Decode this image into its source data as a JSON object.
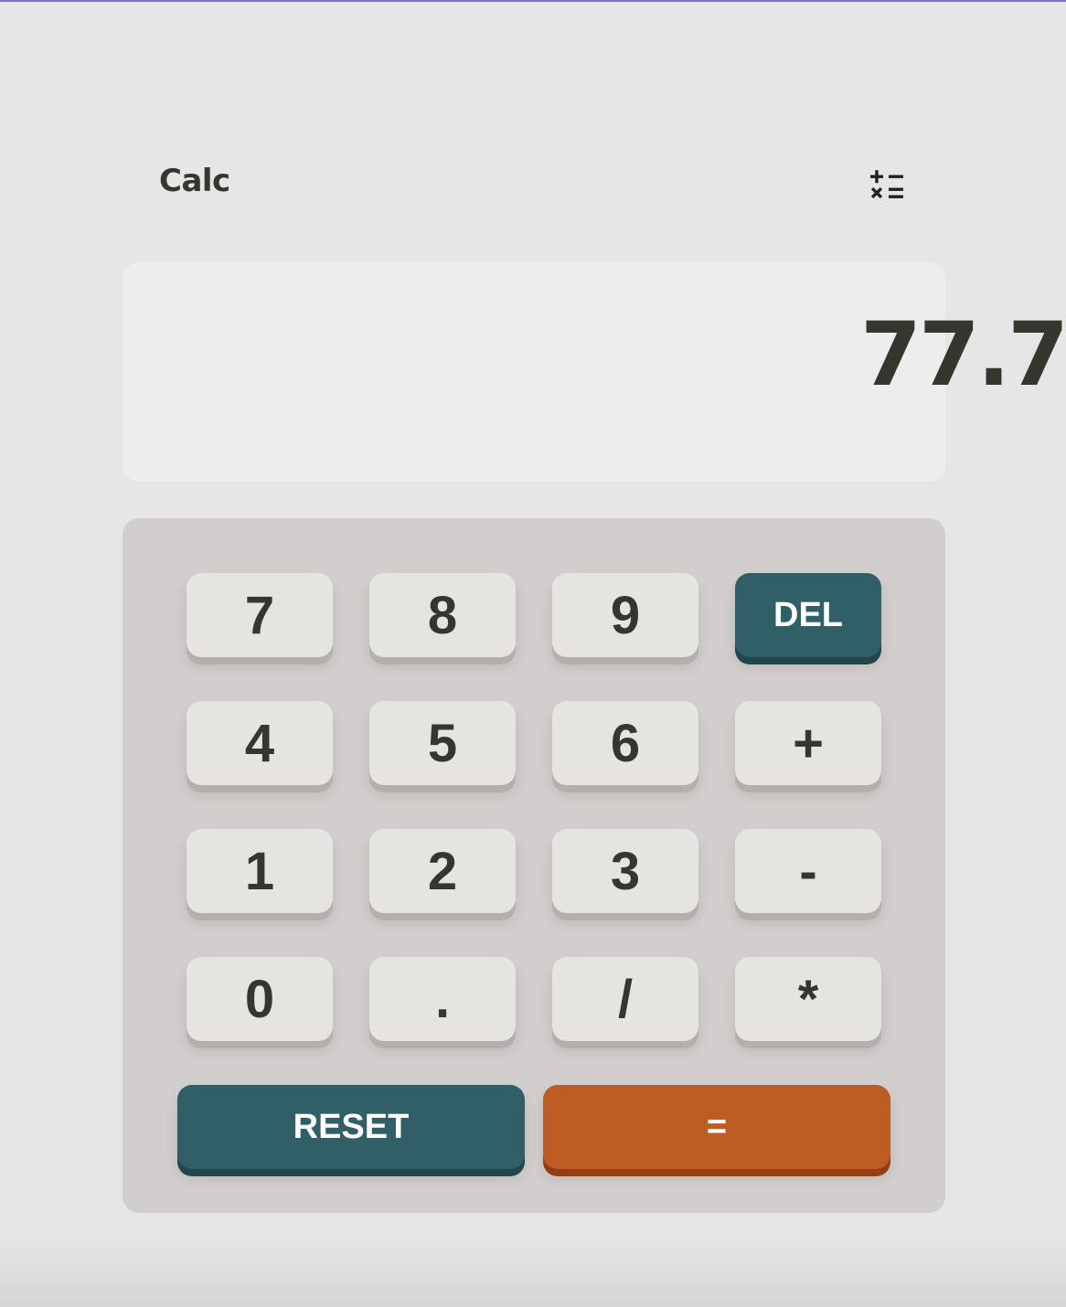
{
  "app": {
    "title": "Calc",
    "icon": "math-operators-icon"
  },
  "display": {
    "value": "77.7"
  },
  "keys": {
    "k7": "7",
    "k8": "8",
    "k9": "9",
    "del": "DEL",
    "k4": "4",
    "k5": "5",
    "k6": "6",
    "plus": "+",
    "k1": "1",
    "k2": "2",
    "k3": "3",
    "minus": "-",
    "k0": "0",
    "dot": ".",
    "divide": "/",
    "multiply": "*",
    "reset": "RESET",
    "equals": "="
  },
  "colors": {
    "background": "#e6e6e6",
    "display": "#ededed",
    "keypad": "#d2cecd",
    "key": "#e6e4e1",
    "key_shadow": "#b5aeab",
    "text": "#36362f",
    "accent_teal": "#305f67",
    "accent_orange": "#bd5c23"
  }
}
